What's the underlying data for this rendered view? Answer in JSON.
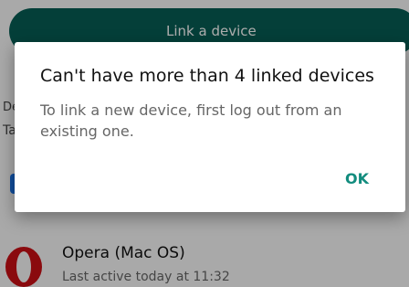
{
  "background": {
    "link_button_label": "Link a device",
    "snippet_a": "De",
    "snippet_b": "Ta",
    "device": {
      "name": "Opera (Mac OS)",
      "last_active": "Last active today at 11:32"
    }
  },
  "dialog": {
    "title": "Can't have more than 4 linked devices",
    "message": "To link a new device, first log out from an existing one.",
    "ok_label": "OK"
  },
  "colors": {
    "brand_dark": "#075e54",
    "accent": "#128c7e",
    "opera_red": "#cc0f16"
  },
  "icons": {
    "device_icon": "opera-logo-icon"
  }
}
